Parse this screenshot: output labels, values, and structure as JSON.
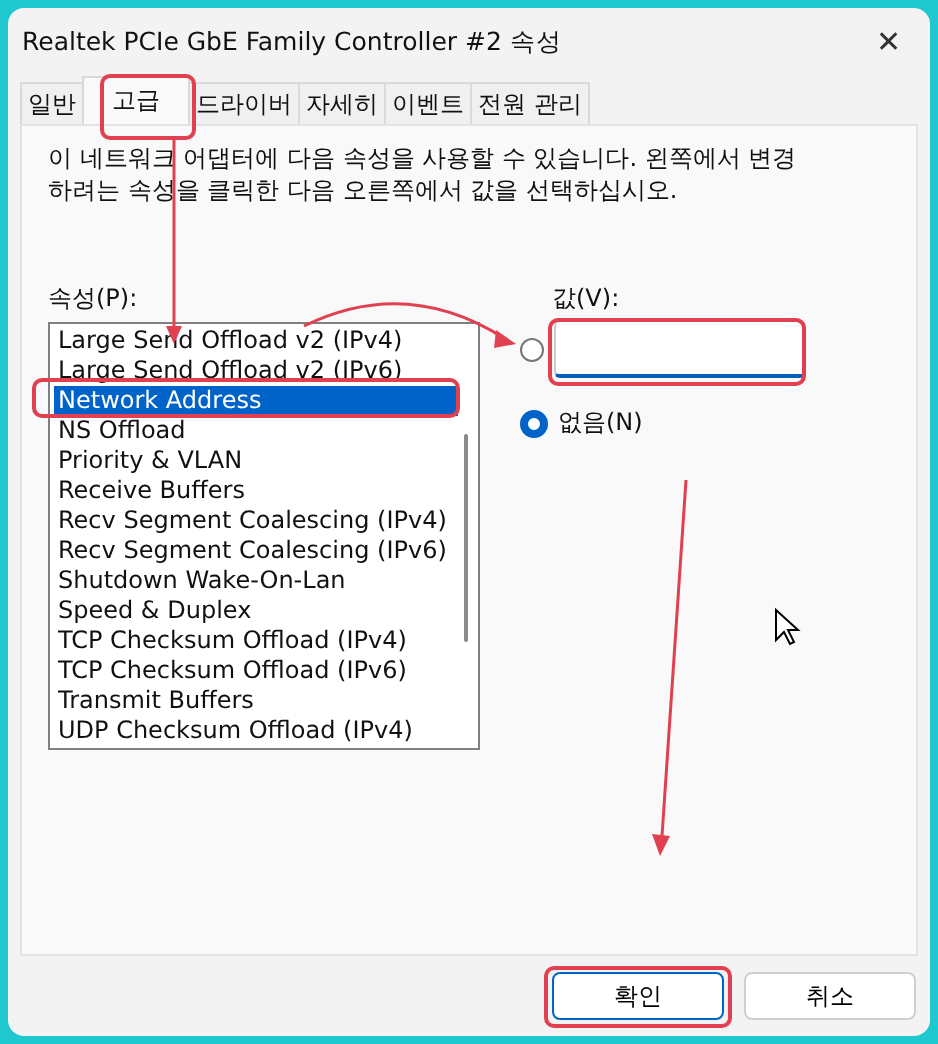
{
  "window": {
    "title": "Realtek PCIe GbE Family Controller #2 속성",
    "close": "✕"
  },
  "tabs": [
    {
      "label": "일반",
      "selected": false
    },
    {
      "label": "고급",
      "selected": true
    },
    {
      "label": "드라이버",
      "selected": false
    },
    {
      "label": "자세히",
      "selected": false
    },
    {
      "label": "이벤트",
      "selected": false
    },
    {
      "label": "전원 관리",
      "selected": false
    }
  ],
  "description": "이 네트워크 어댑터에 다음 속성을 사용할 수 있습니다. 왼쪽에서 변경하려는 속성을 클릭한 다음 오른쪽에서 값을 선택하십시오.",
  "properties": {
    "label": "속성(P):",
    "items": [
      {
        "label": "Large Send Offload v2 (IPv4)",
        "selected": false
      },
      {
        "label": "Large Send Offload v2 (IPv6)",
        "selected": false
      },
      {
        "label": "Network Address",
        "selected": true
      },
      {
        "label": "NS Offload",
        "selected": false
      },
      {
        "label": "Priority & VLAN",
        "selected": false
      },
      {
        "label": "Receive Buffers",
        "selected": false
      },
      {
        "label": "Recv Segment Coalescing (IPv4)",
        "selected": false
      },
      {
        "label": "Recv Segment Coalescing (IPv6)",
        "selected": false
      },
      {
        "label": "Shutdown Wake-On-Lan",
        "selected": false
      },
      {
        "label": "Speed & Duplex",
        "selected": false
      },
      {
        "label": "TCP Checksum Offload (IPv4)",
        "selected": false
      },
      {
        "label": "TCP Checksum Offload (IPv6)",
        "selected": false
      },
      {
        "label": "Transmit Buffers",
        "selected": false
      },
      {
        "label": "UDP Checksum Offload (IPv4)",
        "selected": false
      }
    ]
  },
  "value": {
    "label": "값(V):",
    "options": [
      {
        "kind": "field",
        "selected": false
      },
      {
        "kind": "none",
        "label": "없음(N)",
        "selected": true
      }
    ]
  },
  "buttons": [
    {
      "label": "확인",
      "primary": true
    },
    {
      "label": "취소",
      "primary": false
    }
  ]
}
